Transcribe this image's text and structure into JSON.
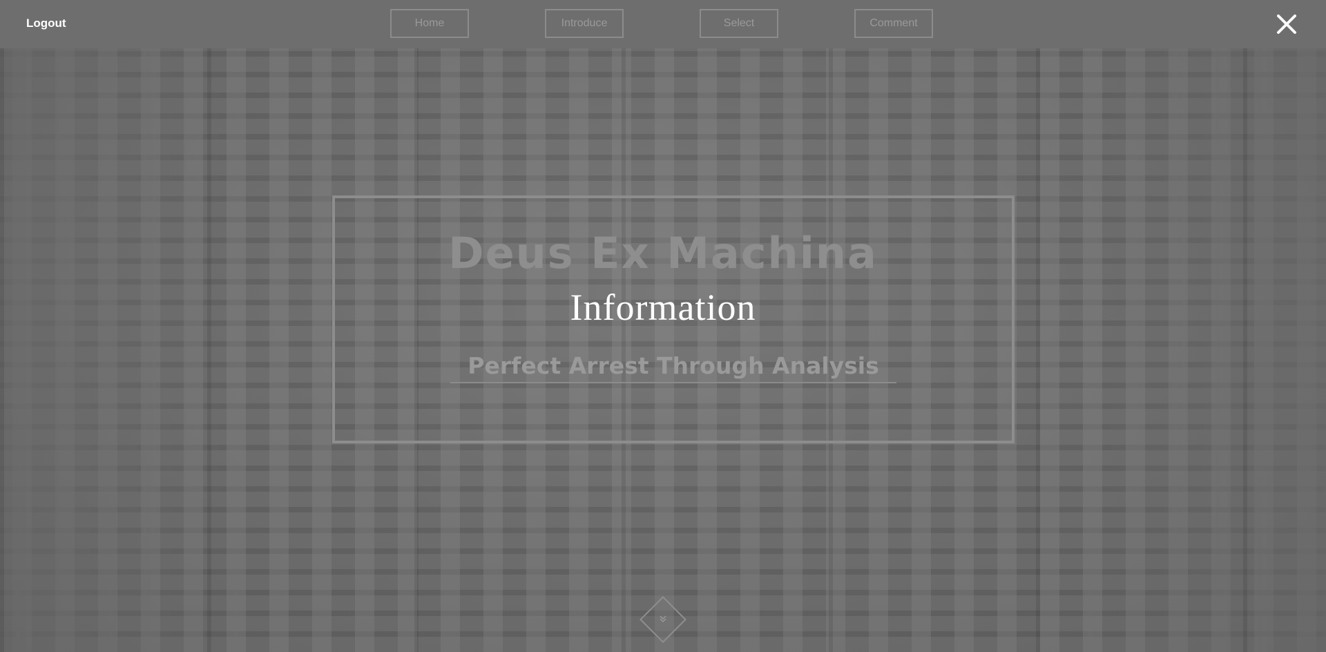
{
  "header": {
    "logout_label": "Logout",
    "nav": [
      {
        "label": "Home"
      },
      {
        "label": "Introduce"
      },
      {
        "label": "Select"
      },
      {
        "label": "Comment"
      }
    ],
    "close_icon": "close-icon"
  },
  "hero": {
    "brand": "Deus Ex Machina",
    "heading": "Information",
    "tagline": "Perfect Arrest Through Analysis"
  },
  "scroll": {
    "icon": "chevron-double-down-icon",
    "glyph": "»"
  },
  "colors": {
    "background": "#6b6b6b",
    "heading_text": "#ffffff",
    "muted_text": "#9a9a9a",
    "frame_border": "#8d8d8d"
  }
}
